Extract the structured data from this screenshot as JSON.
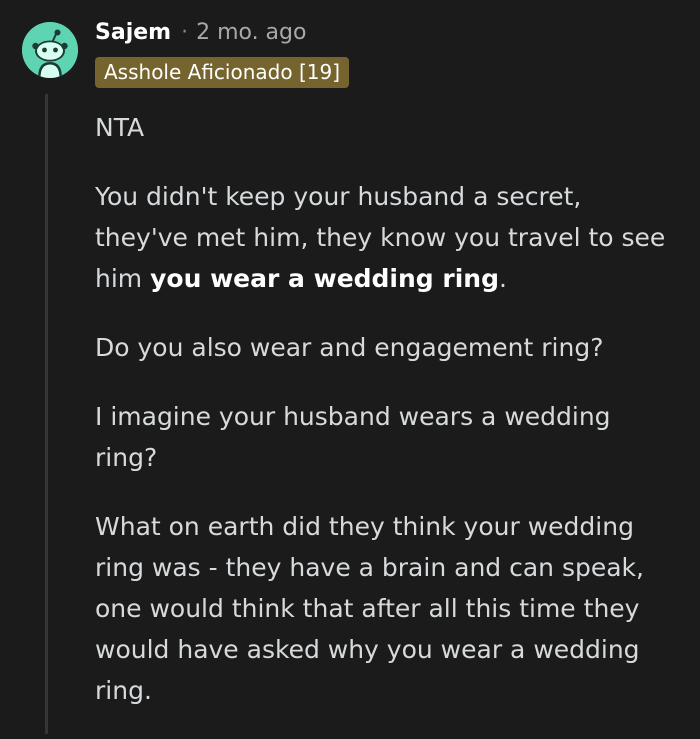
{
  "comment": {
    "author": "Sajem",
    "separator": "·",
    "time": "2 mo. ago",
    "flair": "Asshole Aficionado [19]",
    "paragraphs": {
      "p1": "NTA",
      "p2_a": "You didn't keep your husband a secret, they've met him, they know you travel to see him ",
      "p2_bold": "you wear a wedding ring",
      "p2_c": ".",
      "p3": "Do you also wear and engagement ring?",
      "p4": "I imagine your husband wears a wedding ring?",
      "p5": "What on earth did they think your wedding ring was - they have a brain and can speak, one would think that after all this time they would have asked why you wear a wedding ring."
    }
  },
  "colors": {
    "background": "#1b1b1b",
    "avatar": "#5fd4b2",
    "flair_bg": "#76642f",
    "text": "#d7dadc"
  },
  "icons": {
    "avatar": "reddit-snoo-avatar-icon"
  }
}
